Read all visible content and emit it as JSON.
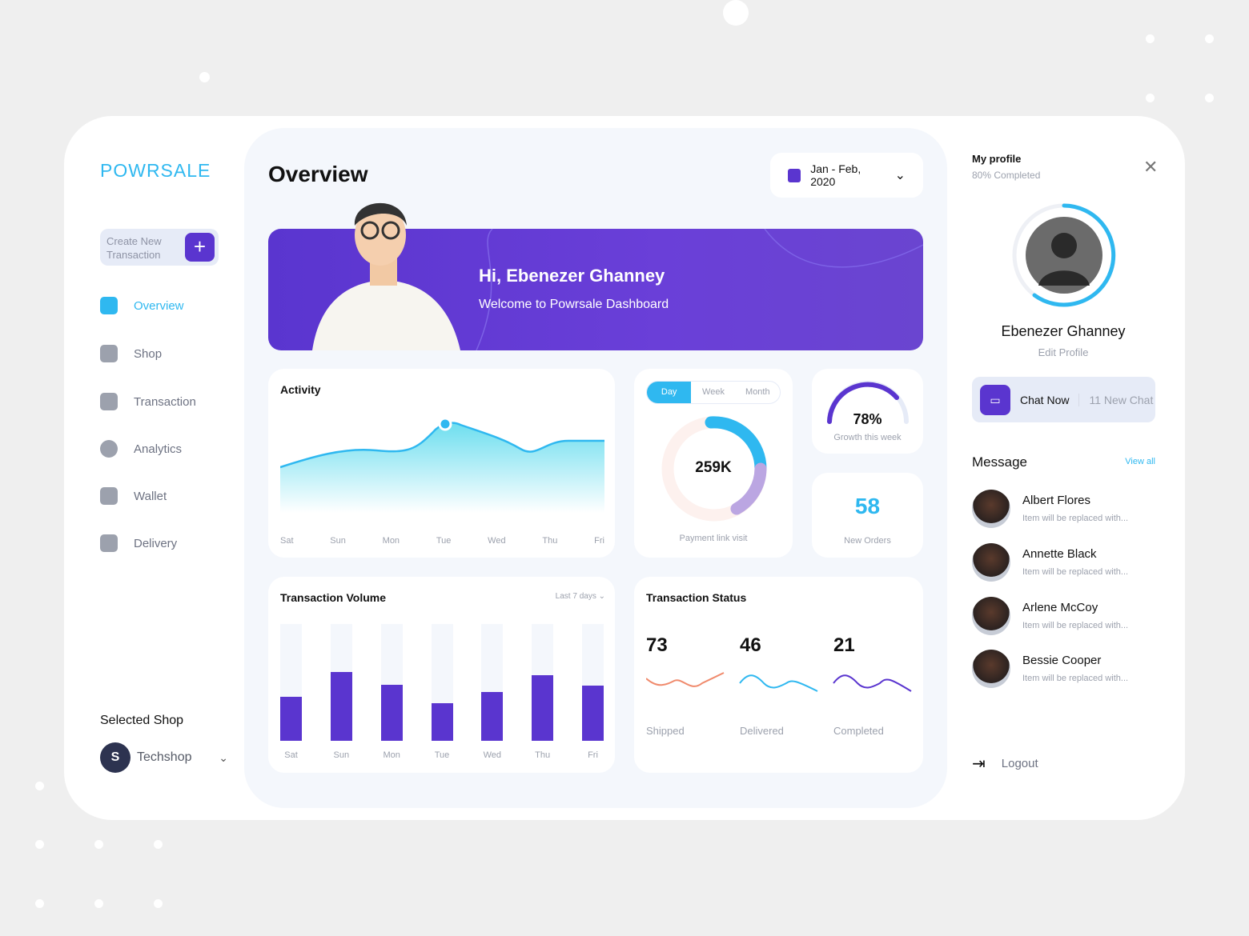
{
  "brand": {
    "logo": "POWRSALE",
    "accent": "#2fb8f0",
    "primary": "#5a35cf"
  },
  "sidebar": {
    "create_label": "Create New Transaction",
    "items": [
      {
        "label": "Overview",
        "icon": "overview-icon",
        "active": true
      },
      {
        "label": "Shop",
        "icon": "shop-bag-icon"
      },
      {
        "label": "Transaction",
        "icon": "transaction-icon"
      },
      {
        "label": "Analytics",
        "icon": "analytics-pie-icon"
      },
      {
        "label": "Wallet",
        "icon": "wallet-icon"
      },
      {
        "label": "Delivery",
        "icon": "gift-icon"
      }
    ],
    "selected_shop_title": "Selected Shop",
    "shop_name": "Techshop",
    "shop_avatar_letter": "S"
  },
  "header": {
    "title": "Overview",
    "date_range": "Jan - Feb, 2020"
  },
  "banner": {
    "greeting": "Hi, Ebenezer Ghanney",
    "subtitle": "Welcome to Powrsale Dashboard"
  },
  "activity": {
    "title": "Activity",
    "days": [
      "Sat",
      "Sun",
      "Mon",
      "Tue",
      "Wed",
      "Thu",
      "Fri"
    ]
  },
  "payment": {
    "tabs": [
      "Day",
      "Week",
      "Month"
    ],
    "active_tab": "Day",
    "value": "259K",
    "label": "Payment link visit"
  },
  "growth": {
    "value": "78%",
    "percent": 78,
    "label": "Growth this week"
  },
  "orders": {
    "value": "58",
    "label": "New Orders"
  },
  "chart_data": {
    "type": "bar",
    "title": "Transaction Volume",
    "filter": "Last 7 days",
    "categories": [
      "Sat",
      "Sun",
      "Mon",
      "Tue",
      "Wed",
      "Thu",
      "Fri"
    ],
    "values": [
      38,
      59,
      48,
      32,
      42,
      56,
      47
    ],
    "ylim": [
      0,
      100
    ]
  },
  "status": {
    "title": "Transaction Status",
    "items": [
      {
        "value": "73",
        "label": "Shipped",
        "color": "#f08a6c"
      },
      {
        "value": "46",
        "label": "Delivered",
        "color": "#2fb8f0"
      },
      {
        "value": "21",
        "label": "Completed",
        "color": "#5a35cf"
      }
    ]
  },
  "profile": {
    "title": "My profile",
    "completion": "80% Completed",
    "name": "Ebenezer Ghanney",
    "edit": "Edit Profile",
    "chat": "Chat Now",
    "new_chat": "11 New Chat"
  },
  "messages": {
    "title": "Message",
    "view_all": "View all",
    "items": [
      {
        "name": "Albert Flores",
        "preview": "Item will be replaced with..."
      },
      {
        "name": "Annette Black",
        "preview": "Item will be replaced with..."
      },
      {
        "name": "Arlene McCoy",
        "preview": "Item will be replaced with..."
      },
      {
        "name": "Bessie Cooper",
        "preview": "Item will be replaced with..."
      }
    ]
  },
  "logout": "Logout"
}
